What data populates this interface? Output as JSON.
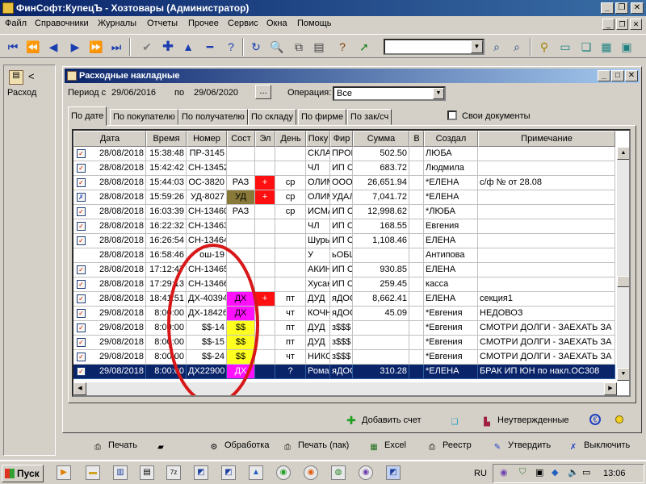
{
  "window": {
    "title": "ФинСофт:КупецЪ - Хозтовары  (Администратор)"
  },
  "menu": [
    "Файл",
    "Справочники",
    "Журналы",
    "Отчеты",
    "Прочее",
    "Сервис",
    "Окна",
    "Помощь"
  ],
  "left_panel": {
    "label": "Расход"
  },
  "doc_window": {
    "title": "Расходные накладные",
    "period_label": "Период с",
    "date_from": "29/06/2016",
    "po_label": "по",
    "date_to": "29/06/2020",
    "ellipsis": "...",
    "operation_label": "Операция:",
    "operation_value": "Все",
    "own_docs_label": "Свои документы"
  },
  "tabs": [
    "По дате",
    "По покупателю",
    "По получателю",
    "По складу",
    "По фирме",
    "По зак/сч"
  ],
  "columns": [
    "Дата",
    "Время",
    "Номер",
    "Сост",
    "Эл",
    "День",
    "Поку",
    "Фир",
    "Сумма",
    "В",
    "Создал",
    "Примечание"
  ],
  "rows": [
    {
      "date": "28/08/2018",
      "time": "15:38:48",
      "num": "ПР-3145",
      "sost": "",
      "el": "",
      "day": "",
      "buyer": "СКЛА",
      "firm": "ПРОВ",
      "sum": "502.50",
      "v": "",
      "creator": "ЛЮБА",
      "note": ""
    },
    {
      "date": "28/08/2018",
      "time": "15:42:42",
      "num": "СН-13452",
      "sost": "",
      "el": "",
      "day": "",
      "buyer": "ЧЛ",
      "firm": "ИП С",
      "sum": "683.72",
      "v": "",
      "creator": "Людмила",
      "note": ""
    },
    {
      "date": "28/08/2018",
      "time": "15:44:03",
      "num": "ОС-3820",
      "sost": "РАЗ",
      "el": "+",
      "day": "ср",
      "buyer": "ОЛИМ",
      "firm": "ООО",
      "sum": "26,651.94",
      "v": "",
      "creator": "*ЕЛЕНА",
      "note": "с/ф № от 28.08"
    },
    {
      "date": "28/08/2018",
      "time": "15:59:26",
      "num": "УД-8027",
      "sost": "УД",
      "el": "+",
      "day": "ср",
      "buyer": "ОЛИМ",
      "firm": "УДАЛ",
      "sum": "7,041.72",
      "v": "",
      "creator": "*ЕЛЕНА",
      "note": ""
    },
    {
      "date": "28/08/2018",
      "time": "16:03:39",
      "num": "СН-13460",
      "sost": "РАЗ",
      "el": "",
      "day": "ср",
      "buyer": "ИСМА",
      "firm": "ИП С",
      "sum": "12,998.62",
      "v": "",
      "creator": "*ЛЮБА",
      "note": ""
    },
    {
      "date": "28/08/2018",
      "time": "16:22:32",
      "num": "СН-13463",
      "sost": "",
      "el": "",
      "day": "",
      "buyer": "ЧЛ",
      "firm": "ИП С",
      "sum": "168.55",
      "v": "",
      "creator": "Евгения",
      "note": ""
    },
    {
      "date": "28/08/2018",
      "time": "16:26:54",
      "num": "СН-13464",
      "sost": "",
      "el": "",
      "day": "",
      "buyer": "Шуры",
      "firm": "ИП С",
      "sum": "1,108.46",
      "v": "",
      "creator": "ЕЛЕНА",
      "note": ""
    },
    {
      "date": "28/08/2018",
      "time": "16:58:46",
      "num": "ош-19",
      "sost": "",
      "el": "",
      "day": "",
      "buyer": "У",
      "firm": "ьОБЩ",
      "sum": "",
      "v": "",
      "creator": "Антипова",
      "note": ""
    },
    {
      "date": "28/08/2018",
      "time": "17:12:47",
      "num": "СН-13465",
      "sost": "",
      "el": "",
      "day": "",
      "buyer": "АКИН",
      "firm": "ИП С",
      "sum": "930.85",
      "v": "",
      "creator": "ЕЛЕНА",
      "note": ""
    },
    {
      "date": "28/08/2018",
      "time": "17:29:13",
      "num": "СН-13466",
      "sost": "",
      "el": "",
      "day": "",
      "buyer": "Хусан",
      "firm": "ИП С",
      "sum": "259.45",
      "v": "",
      "creator": "касса",
      "note": ""
    },
    {
      "date": "28/08/2018",
      "time": "18:41:51",
      "num": "ДХ-40394",
      "sost": "ДХ",
      "el": "+",
      "day": "пт",
      "buyer": "ДУД",
      "firm": "яДОС",
      "sum": "8,662.41",
      "v": "",
      "creator": "ЕЛЕНА",
      "note": "секция1"
    },
    {
      "date": "29/08/2018",
      "time": "8:00:00",
      "num": "ДХ-18426",
      "sost": "ДХ",
      "el": "",
      "day": "чт",
      "buyer": "КОЧН",
      "firm": "яДОС",
      "sum": "45.09",
      "v": "",
      "creator": "*Евгения",
      "note": "НЕДОВОЗ"
    },
    {
      "date": "29/08/2018",
      "time": "8:00:00",
      "num": "$$-14",
      "sost": "$$",
      "el": "",
      "day": "пт",
      "buyer": "ДУД",
      "firm": "з$$$",
      "sum": "",
      "v": "",
      "creator": "*Евгения",
      "note": "СМОТРИ ДОЛГИ  - ЗАЕХАТЬ ЗА"
    },
    {
      "date": "29/08/2018",
      "time": "8:00:00",
      "num": "$$-15",
      "sost": "$$",
      "el": "",
      "day": "пт",
      "buyer": "ДУД",
      "firm": "з$$$",
      "sum": "",
      "v": "",
      "creator": "*Евгения",
      "note": "СМОТРИ ДОЛГИ  - ЗАЕХАТЬ ЗА"
    },
    {
      "date": "29/08/2018",
      "time": "8:00:00",
      "num": "$$-24",
      "sost": "$$",
      "el": "",
      "day": "чт",
      "buyer": "НИКС",
      "firm": "з$$$",
      "sum": "",
      "v": "",
      "creator": "*Евгения",
      "note": "СМОТРИ ДОЛГИ  - ЗАЕХАТЬ ЗА"
    },
    {
      "date": "29/08/2018",
      "time": "8:00:00",
      "num": "ДХ22900",
      "sost": "ДХ",
      "el": "",
      "day": "?",
      "buyer": "Рома",
      "firm": "яДОС",
      "sum": "310.28",
      "v": "",
      "creator": "*ЕЛЕНА",
      "note": "БРАК      ИП ЮН по накл.ОС308"
    }
  ],
  "inner_bottom": {
    "add_invoice": "Добавить счет",
    "unconfirmed": "Неутвержденные"
  },
  "bottom_toolbar": [
    "Печать",
    "Обработка",
    "Печать (пак)",
    "Excel",
    "Реестр",
    "Утвердить",
    "Выключить"
  ],
  "taskbar": {
    "start": "Пуск",
    "lang": "RU",
    "clock": "13:06",
    "app_icon_label": "7z"
  },
  "colors": {
    "title_blue": "#0a246a",
    "el_red": "#ff1010",
    "ud_olive": "#8a7a3a",
    "dx_magenta": "#ff10ff",
    "dollar_yellow": "#ffff20",
    "circle_red": "#d81818",
    "selected_row": "#0a246a"
  }
}
